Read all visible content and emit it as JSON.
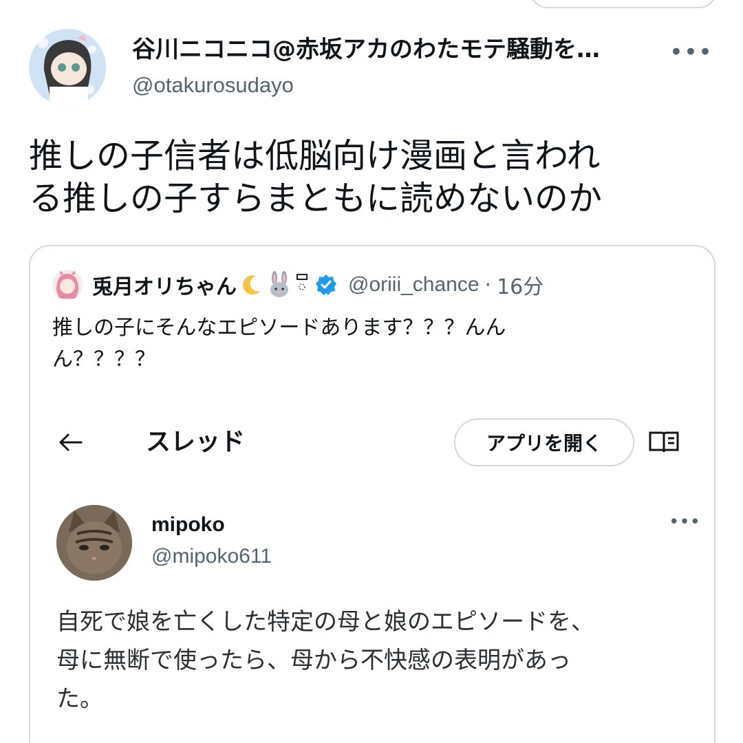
{
  "tweet": {
    "display_name": "谷川ニコニコ@赤坂アカのわたモテ騒動を…",
    "handle": "@otakurosudayo",
    "more": "•••",
    "text_lines": [
      "推しの子信者は低脳向け漫画と言われ",
      "る推しの子すらまともに読めないのか"
    ]
  },
  "quote": {
    "display_name": "兎月オリちゃん",
    "emoji": [
      "moon-icon",
      "rabbit-icon",
      "ribbon-icon"
    ],
    "handle": "@oriii_chance",
    "separator": "·",
    "time": "16分",
    "text_lines": [
      "推しの子にそんなエピソードあります？？？んん",
      "ん？？？？"
    ],
    "embedded_thread": {
      "title": "スレッド",
      "open_app_label": "アプリを開く",
      "post": {
        "display_name": "mipoko",
        "handle": "@mipoko611",
        "more": "•••",
        "text_lines": [
          "自死で娘を亡くした特定の母と娘のエピソードを、",
          "母に無断で使ったら、母から不快感の表明があっ",
          "た。"
        ]
      }
    }
  },
  "colors": {
    "text_primary": "#0f1419",
    "text_secondary": "#536471",
    "border": "#cfd9de",
    "verified": "#1d9bf0"
  }
}
